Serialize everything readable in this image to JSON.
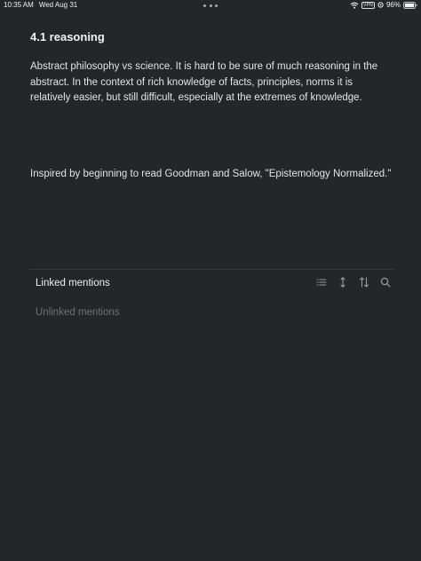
{
  "status_bar": {
    "time": "10:35 AM",
    "date": "Wed Aug 31",
    "vpn_label": "VPN",
    "battery_percent": "96%"
  },
  "page": {
    "title": "4.1 reasoning",
    "blocks": [
      "Abstract philosophy vs science. It is hard to be sure of much reasoning in the abstract. In the context of rich knowledge of facts, principles, norms it is relatively easier, but still difficult, especially at the extremes of knowledge.",
      "Inspired by beginning to read Goodman and Salow, \"Epistemology Normalized.\""
    ]
  },
  "references": {
    "linked_label": "Linked mentions",
    "unlinked_label": "Unlinked mentions",
    "toolbar_icons": [
      "list-icon",
      "expand-collapse-icon",
      "sort-icon",
      "search-icon"
    ]
  },
  "colors": {
    "background": "#252629",
    "text_primary": "#e3e3e5",
    "text_muted": "#6f7075",
    "icon": "#9a9ba0"
  }
}
